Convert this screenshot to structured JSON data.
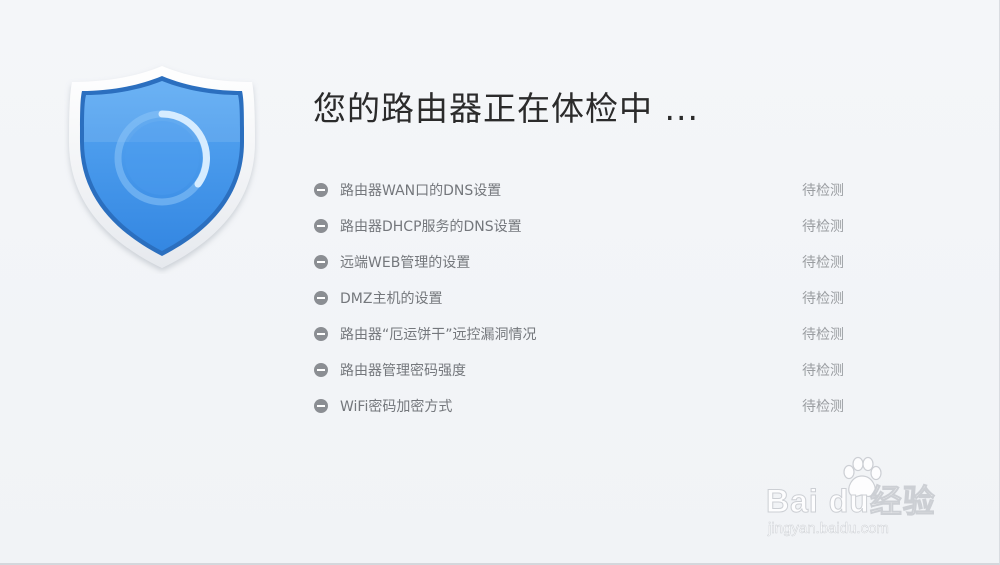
{
  "header": {
    "title": "您的路由器正在体检中 ..."
  },
  "checklist": {
    "items": [
      {
        "label": "路由器WAN口的DNS设置",
        "status": "待检测",
        "icon": "minus-circle-icon"
      },
      {
        "label": "路由器DHCP服务的DNS设置",
        "status": "待检测",
        "icon": "minus-circle-icon"
      },
      {
        "label": "远端WEB管理的设置",
        "status": "待检测",
        "icon": "minus-circle-icon"
      },
      {
        "label": "DMZ主机的设置",
        "status": "待检测",
        "icon": "minus-circle-icon"
      },
      {
        "label": "路由器“厄运饼干”远控漏洞情况",
        "status": "待检测",
        "icon": "minus-circle-icon"
      },
      {
        "label": "路由器管理密码强度",
        "status": "待检测",
        "icon": "minus-circle-icon"
      },
      {
        "label": "WiFi密码加密方式",
        "status": "待检测",
        "icon": "minus-circle-icon"
      }
    ]
  },
  "shield": {
    "icon": "shield-scanning-icon",
    "fill_color": "#3d93ea",
    "border_color": "#2a6fc0"
  },
  "watermark": {
    "logo_text": "Bai du经验",
    "sub_text": "jingyan.baidu.com"
  },
  "colors": {
    "background": "#f3f5f8",
    "title_text": "#2b2b2b",
    "item_text": "#74777c",
    "status_text": "#9a9da1",
    "icon_gray": "#8b8e93"
  }
}
